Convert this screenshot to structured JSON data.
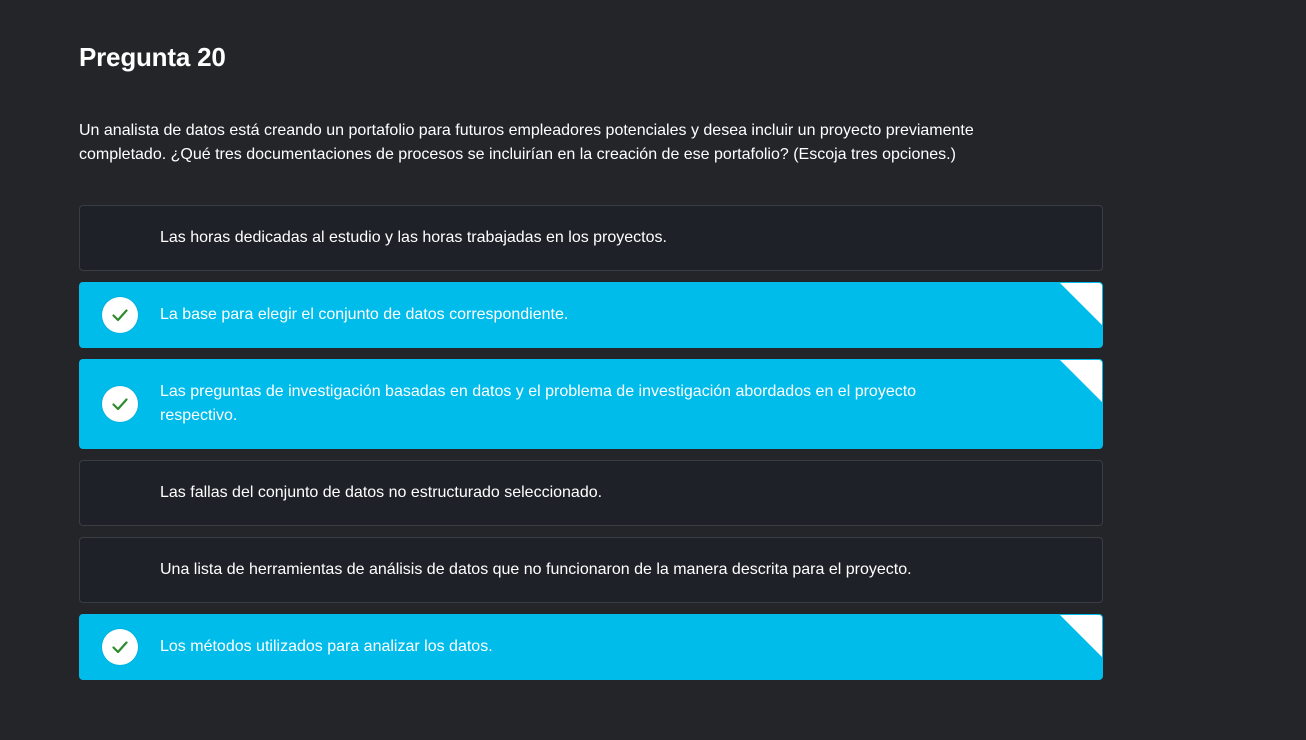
{
  "question": {
    "title": "Pregunta 20",
    "text": "Un analista de datos está creando un portafolio para futuros empleadores potenciales y desea incluir un proyecto previamente completado. ¿Qué tres documentaciones de procesos se incluirían en la creación de ese portafolio? (Escoja tres opciones.)"
  },
  "options": [
    {
      "label": "Las horas dedicadas al estudio y las horas trabajadas en los proyectos.",
      "selected": false
    },
    {
      "label": "La base para elegir el conjunto de datos correspondiente.",
      "selected": true
    },
    {
      "label": "Las preguntas de investigación basadas en datos y el problema de investigación abordados en el proyecto respectivo.",
      "selected": true
    },
    {
      "label": "Las fallas del conjunto de datos no estructurado seleccionado.",
      "selected": false
    },
    {
      "label": "Una lista de herramientas de análisis de datos que no funcionaron de la manera descrita para el proyecto.",
      "selected": false
    },
    {
      "label": "Los métodos utilizados para analizar los datos.",
      "selected": true
    }
  ],
  "colors": {
    "background": "#242529",
    "option_bg": "#1f2129",
    "selected_bg": "#00bceb",
    "check_color": "#2e8b2e"
  }
}
